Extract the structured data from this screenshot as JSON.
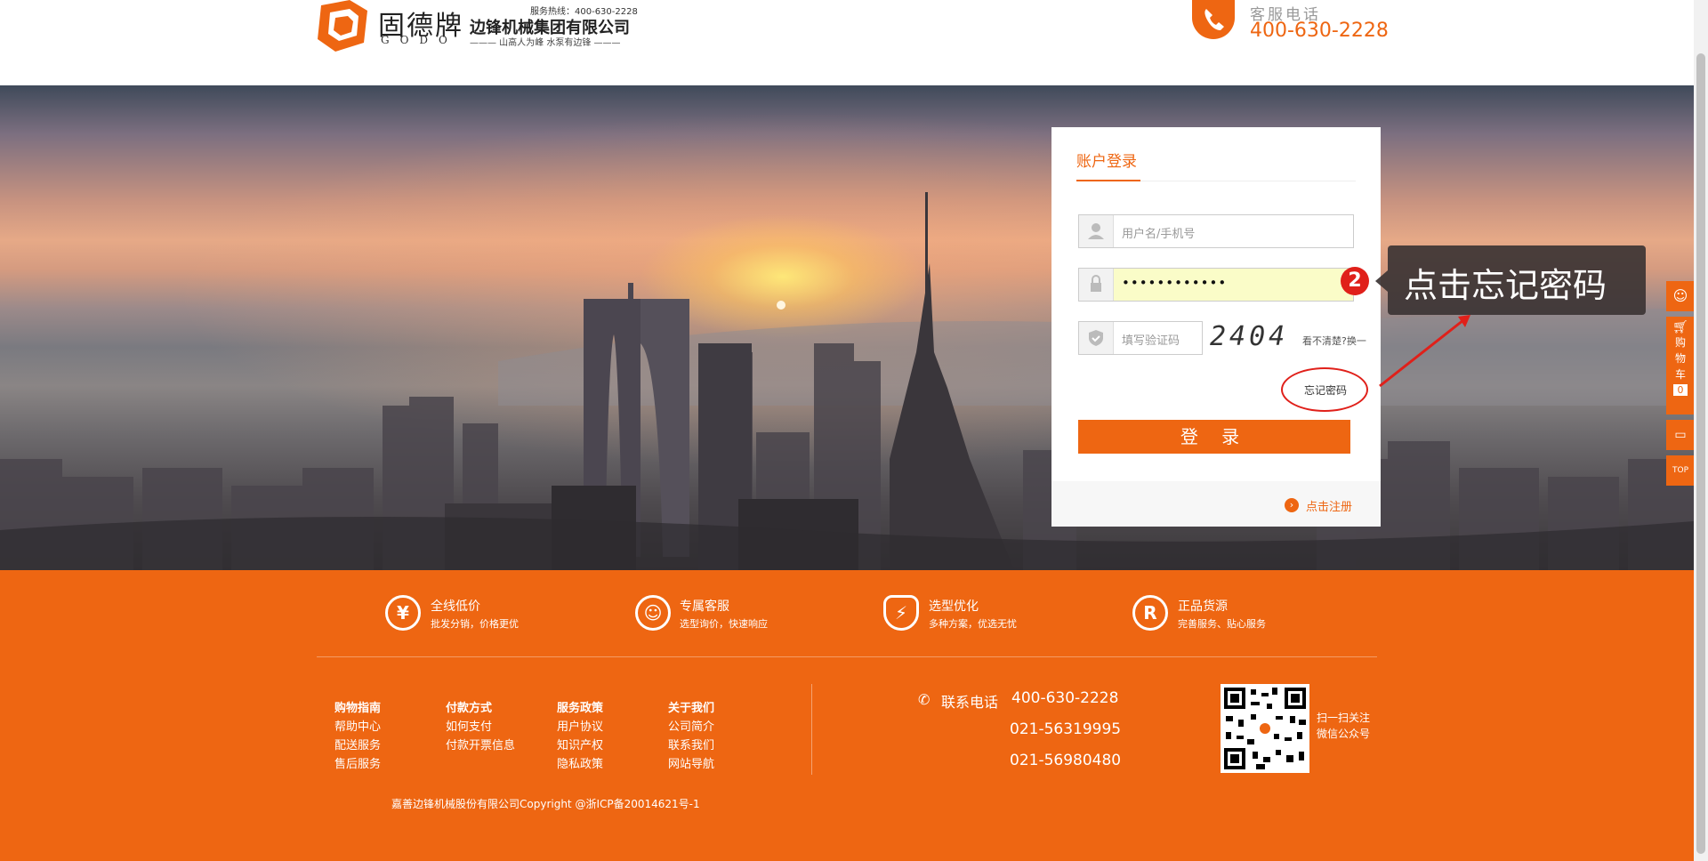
{
  "header": {
    "brand_cn": "固德牌",
    "brand_en": "GODO",
    "hotline_small": "服务热线：400-630-2228",
    "company": "边锋机械集团有限公司",
    "slogan": "——— 山高人为峰 水泵有边锋 ———",
    "service_label": "客服电话",
    "service_phone": "400-630-2228"
  },
  "login": {
    "title": "账户登录",
    "username_placeholder": "用户名/手机号",
    "password_value": "••••••••••••",
    "captcha_placeholder": "填写验证码",
    "captcha_text": "2404",
    "captcha_refresh": "看不清楚?换一",
    "forgot_password": "忘记密码",
    "submit_label": "登 录",
    "register_link": "点击注册"
  },
  "annotation": {
    "step": "2",
    "tip_text": "点击忘记密码"
  },
  "sidebar": {
    "cart_label": [
      "购",
      "物",
      "车"
    ],
    "cart_count": "0",
    "top_label": "TOP"
  },
  "footer": {
    "features": [
      {
        "title": "全线低价",
        "subtitle": "批发分销，价格更优",
        "icon": "yen-icon",
        "glyph": "¥"
      },
      {
        "title": "专属客服",
        "subtitle": "选型询价，快速响应",
        "icon": "headset-icon",
        "glyph": "☺"
      },
      {
        "title": "选型优化",
        "subtitle": "多种方案，优选无忧",
        "icon": "lightning-shield-icon",
        "glyph": "⚡"
      },
      {
        "title": "正品货源",
        "subtitle": "完善服务、贴心服务",
        "icon": "registered-icon",
        "glyph": "R"
      }
    ],
    "columns": [
      {
        "heading": "购物指南",
        "links": [
          "帮助中心",
          "配送服务",
          "售后服务"
        ]
      },
      {
        "heading": "付款方式",
        "links": [
          "如何支付",
          "付款开票信息"
        ]
      },
      {
        "heading": "服务政策",
        "links": [
          "用户协议",
          "知识产权",
          "隐私政策"
        ]
      },
      {
        "heading": "关于我们",
        "links": [
          "公司简介",
          "联系我们",
          "网站导航"
        ]
      }
    ],
    "contact_label": "联系电话",
    "contact_numbers": [
      "400-630-2228",
      "021-56319995",
      "021-56980480"
    ],
    "qr_text_line1": "扫一扫关注",
    "qr_text_line2": "微信公众号",
    "copyright": "嘉善边锋机械股份有限公司Copyright @浙ICP备20014621号-1"
  },
  "colors": {
    "accent": "#ee6612",
    "annotation_red": "#e0201a"
  }
}
